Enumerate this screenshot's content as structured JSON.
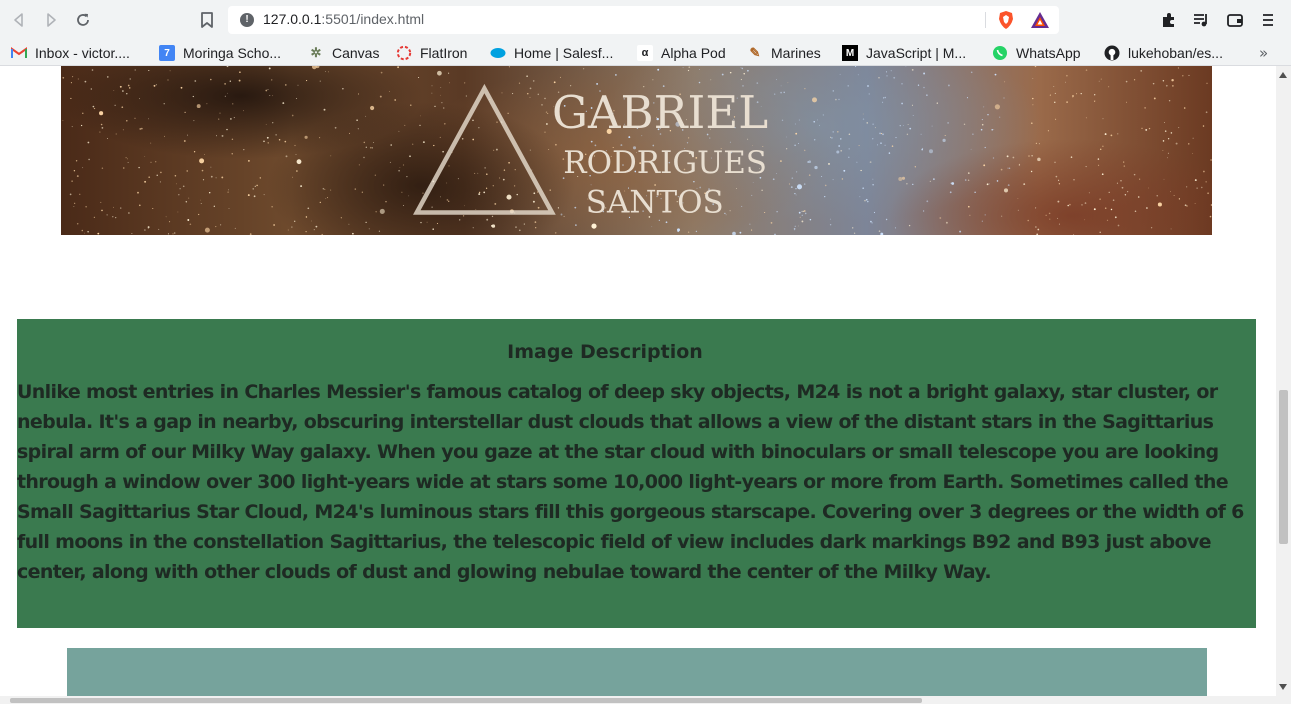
{
  "browser": {
    "url_host": "127.0.0.1",
    "url_path": ":5501/index.html",
    "site_info_glyph": "!"
  },
  "bookmarks": [
    {
      "label": "Inbox - victor....",
      "icon": "gmail-icon",
      "color": "#ea4335"
    },
    {
      "label": "Moringa Scho...",
      "icon": "moringa-icon",
      "color": "#4285f4"
    },
    {
      "label": "Canvas",
      "icon": "canvas-icon",
      "color": "#6b7d5a"
    },
    {
      "label": "FlatIron",
      "icon": "flatiron-icon",
      "color": "#e53935"
    },
    {
      "label": "Home | Salesf...",
      "icon": "salesforce-icon",
      "color": "#00a1e0"
    },
    {
      "label": "Alpha Pod",
      "icon": "alpha-pod-icon",
      "color": "#202124"
    },
    {
      "label": "Marines",
      "icon": "marines-icon",
      "color": "#b0692a"
    },
    {
      "label": "JavaScript | M...",
      "icon": "javascript-m-icon",
      "color": "#000000"
    },
    {
      "label": "WhatsApp",
      "icon": "whatsapp-icon",
      "color": "#25d366"
    },
    {
      "label": "lukehoban/es...",
      "icon": "github-icon",
      "color": "#202124"
    }
  ],
  "bookmarks_overflow": "»",
  "page": {
    "watermark": {
      "line1": "GABRIEL",
      "line2": "RODRIGUES",
      "line3": "SANTOS"
    },
    "description": {
      "title": "Image Description",
      "body": "Unlike most entries in Charles Messier's famous catalog of deep sky objects, M24 is not a bright galaxy, star cluster, or nebula. It's a gap in nearby, obscuring interstellar dust clouds that allows a view of the distant stars in the Sagittarius spiral arm of our Milky Way galaxy. When you gaze at the star cloud with binoculars or small telescope you are looking through a window over 300 light-years wide at stars some 10,000 light-years or more from Earth. Sometimes called the Small Sagittarius Star Cloud, M24's luminous stars fill this gorgeous starscape. Covering over 3 degrees or the width of 6 full moons in the constellation Sagittarius, the telescopic field of view includes dark markings B92 and B93 just above center, along with other clouds of dust and glowing nebulae toward the center of the Milky Way."
    }
  },
  "colors": {
    "description_bg": "#3a7a4f",
    "next_block_bg": "#76a39c",
    "chrome_bg": "#f1f3f4"
  }
}
